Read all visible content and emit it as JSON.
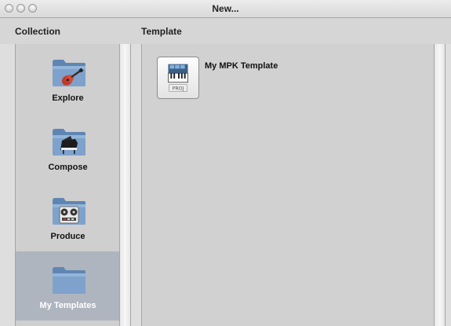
{
  "window": {
    "title": "New..."
  },
  "header": {
    "collection_label": "Collection",
    "template_label": "Template"
  },
  "collections": [
    {
      "label": "Explore",
      "icon": "guitar-icon",
      "selected": false
    },
    {
      "label": "Compose",
      "icon": "piano-icon",
      "selected": false
    },
    {
      "label": "Produce",
      "icon": "tape-reel-icon",
      "selected": false
    },
    {
      "label": "My Templates",
      "icon": "folder-icon",
      "selected": true
    }
  ],
  "templates": [
    {
      "name": "My MPK Template",
      "badge": "PROJ",
      "icon": "keyboard-project-icon"
    }
  ],
  "colors": {
    "selection": "#aeb5bf",
    "folder": "#6f95bf"
  }
}
